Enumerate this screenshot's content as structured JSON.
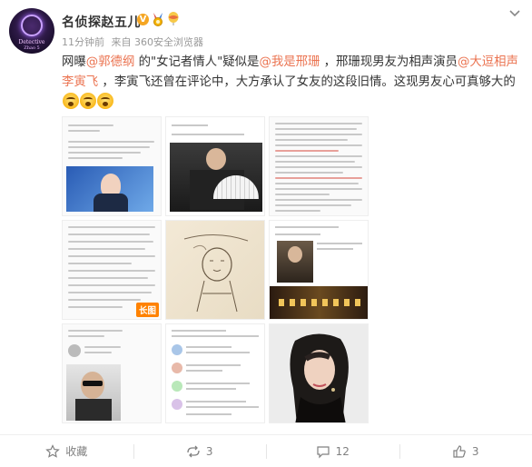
{
  "post": {
    "author": "名侦探赵五儿",
    "avatar_text_1": "Detective",
    "avatar_text_2": "Zhao 5",
    "verified_mark": "V",
    "time": "11分钟前",
    "source": "来自 360安全浏览器",
    "content": {
      "p1": "网曝",
      "m1": "@郭德纲",
      "p2": " 的\"女记者情人\"疑似是",
      "m2": "@我是邢珊",
      "p3": " ，邢珊现男友为相声演员",
      "m3": "@大逗相声李寅飞",
      "p4": " ，李寅飞还曾在评论中，大方承认了女友的这段旧情。这现男友心可真够大的"
    },
    "emojis": [
      "shocked-emoji",
      "shocked-emoji",
      "shocked-emoji"
    ],
    "long_image_tag": "长图"
  },
  "actions": {
    "favorite": "收藏",
    "repost": "3",
    "comment": "12",
    "like": "3"
  },
  "icons": {
    "menu": "chevron-down-icon",
    "favorite": "star-icon",
    "repost": "repost-icon",
    "comment": "comment-icon",
    "like": "thumbs-up-icon"
  },
  "colors": {
    "mention": "#eb7350",
    "vbadge": "#f5a623",
    "long_tag": "#ff8200",
    "meta": "#999999"
  }
}
